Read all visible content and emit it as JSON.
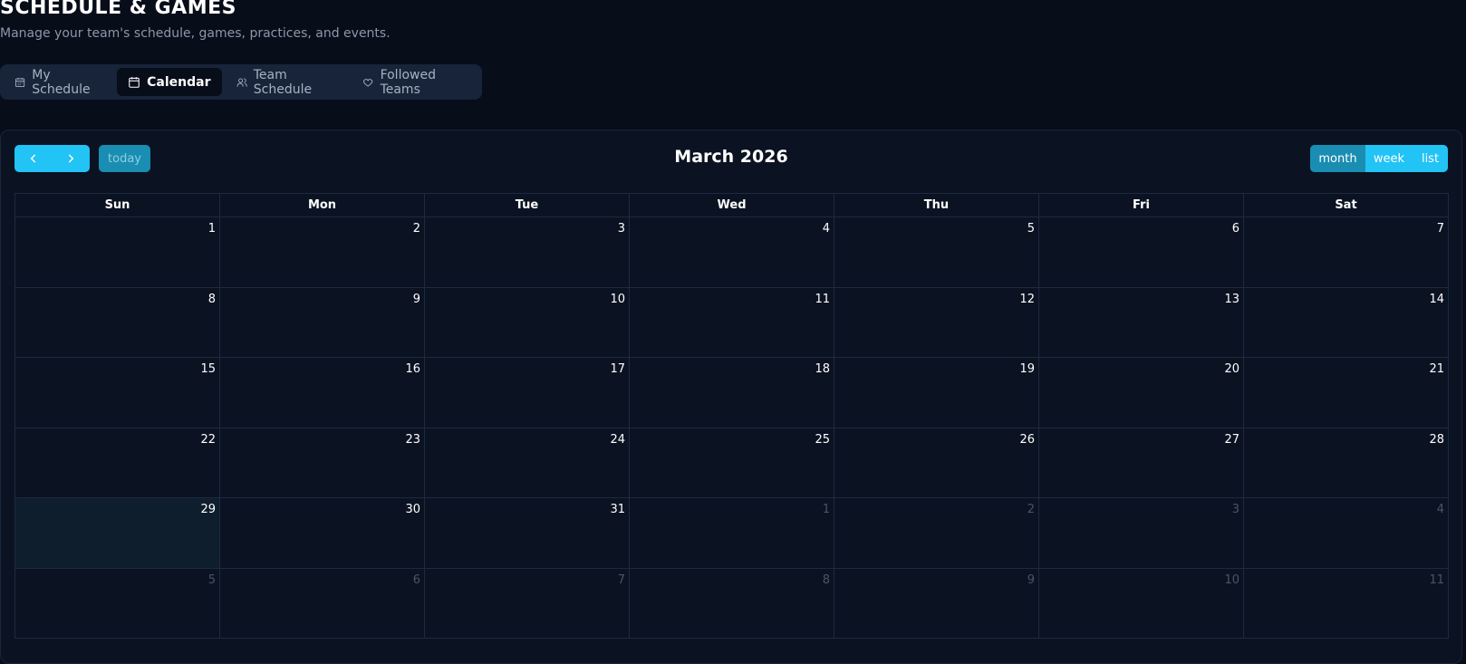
{
  "header": {
    "title": "SCHEDULE & GAMES",
    "subtitle": "Manage your team's schedule, games, practices, and events."
  },
  "tabs": [
    {
      "label": "My Schedule",
      "icon": "calendar-grid-icon",
      "active": false
    },
    {
      "label": "Calendar",
      "icon": "calendar-icon",
      "active": true
    },
    {
      "label": "Team Schedule",
      "icon": "users-icon",
      "active": false
    },
    {
      "label": "Followed Teams",
      "icon": "heart-icon",
      "active": false
    }
  ],
  "toolbar": {
    "prev_icon": "chevron-left-icon",
    "next_icon": "chevron-right-icon",
    "today_label": "today",
    "title": "March 2026",
    "views": [
      "month",
      "week",
      "list"
    ],
    "active_view": "month"
  },
  "calendar": {
    "weekdays": [
      "Sun",
      "Mon",
      "Tue",
      "Wed",
      "Thu",
      "Fri",
      "Sat"
    ],
    "weeks": [
      [
        {
          "d": "1"
        },
        {
          "d": "2"
        },
        {
          "d": "3"
        },
        {
          "d": "4"
        },
        {
          "d": "5"
        },
        {
          "d": "6"
        },
        {
          "d": "7"
        }
      ],
      [
        {
          "d": "8"
        },
        {
          "d": "9"
        },
        {
          "d": "10"
        },
        {
          "d": "11"
        },
        {
          "d": "12"
        },
        {
          "d": "13"
        },
        {
          "d": "14"
        }
      ],
      [
        {
          "d": "15"
        },
        {
          "d": "16"
        },
        {
          "d": "17"
        },
        {
          "d": "18"
        },
        {
          "d": "19"
        },
        {
          "d": "20"
        },
        {
          "d": "21"
        }
      ],
      [
        {
          "d": "22"
        },
        {
          "d": "23"
        },
        {
          "d": "24"
        },
        {
          "d": "25"
        },
        {
          "d": "26"
        },
        {
          "d": "27"
        },
        {
          "d": "28"
        }
      ],
      [
        {
          "d": "29",
          "today": true
        },
        {
          "d": "30"
        },
        {
          "d": "31"
        },
        {
          "d": "1",
          "other": true
        },
        {
          "d": "2",
          "other": true
        },
        {
          "d": "3",
          "other": true
        },
        {
          "d": "4",
          "other": true
        }
      ],
      [
        {
          "d": "5",
          "other": true
        },
        {
          "d": "6",
          "other": true
        },
        {
          "d": "7",
          "other": true
        },
        {
          "d": "8",
          "other": true
        },
        {
          "d": "9",
          "other": true
        },
        {
          "d": "10",
          "other": true
        },
        {
          "d": "11",
          "other": true
        }
      ]
    ]
  },
  "colors": {
    "accent": "#22c3f5",
    "accent_dark": "#1a8db2",
    "background": "#070d19",
    "card": "#0b1222",
    "today_cell": "#0e1e2d"
  }
}
